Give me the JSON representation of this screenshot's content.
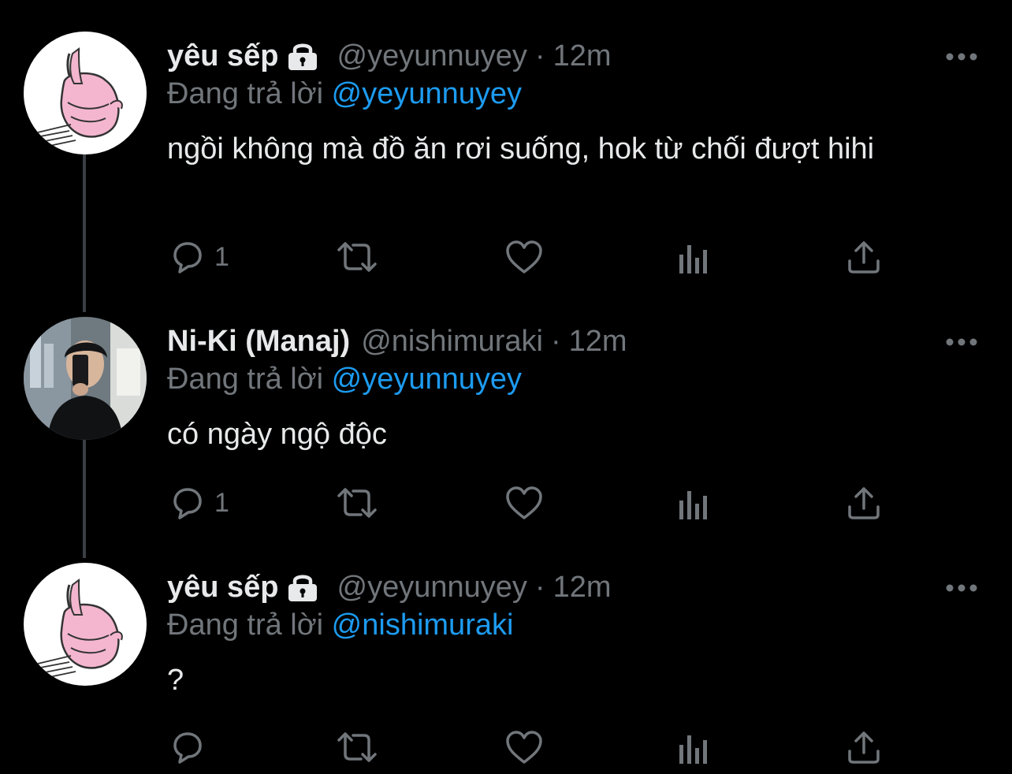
{
  "tweets": [
    {
      "display_name": "yêu sếp",
      "locked": true,
      "handle": "@yeyunnuyey",
      "dot": "·",
      "time": "12m",
      "replying_prefix": "Đang trả lời",
      "replying_to": "@yeyunnuyey",
      "text": "ngồi không mà đồ ăn rơi suống, hok từ chối đượt hihi",
      "reply_count": "1",
      "avatar_icon": "bunny-avatar"
    },
    {
      "display_name": "Ni-Ki (Manaj)",
      "locked": false,
      "handle": "@nishimuraki",
      "dot": "·",
      "time": "12m",
      "replying_prefix": "Đang trả lời",
      "replying_to": "@yeyunnuyey",
      "text": "có ngày ngộ độc",
      "reply_count": "1",
      "avatar_icon": "photo-avatar"
    },
    {
      "display_name": "yêu sếp",
      "locked": true,
      "handle": "@yeyunnuyey",
      "dot": "·",
      "time": "12m",
      "replying_prefix": "Đang trả lời",
      "replying_to": "@nishimuraki",
      "text": "?",
      "reply_count": "",
      "avatar_icon": "bunny-avatar"
    }
  ],
  "icons": {
    "reply": "reply-icon",
    "retweet": "retweet-icon",
    "like": "heart-icon",
    "analytics": "analytics-icon",
    "share": "share-icon",
    "more": "more-icon",
    "lock": "lock-icon"
  },
  "colors": {
    "background": "#000000",
    "text": "#e7e9ea",
    "secondary": "#71767b",
    "mention": "#1d9bf0",
    "thread_line": "#3a3f44"
  }
}
